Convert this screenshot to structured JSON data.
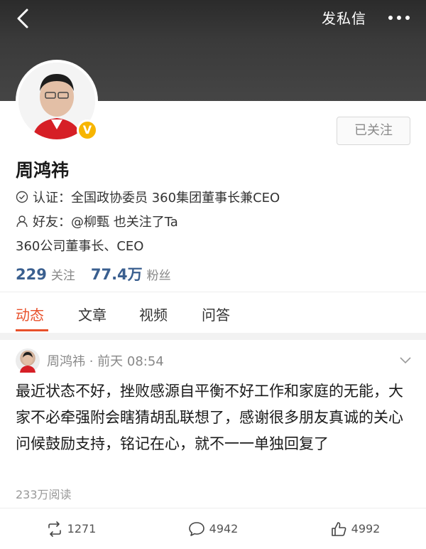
{
  "header": {
    "dm_label": "发私信"
  },
  "profile": {
    "name": "周鸿祎",
    "follow_button": "已关注",
    "cert_label": "认证：",
    "cert_text": "全国政协委员 360集团董事长兼CEO",
    "friend_label": "好友：",
    "friend_text": "@柳甄 也关注了Ta",
    "description": "360公司董事长、CEO",
    "following_count": "229",
    "following_label": "关注",
    "followers_count": "77.4万",
    "followers_label": "粉丝",
    "verified_badge": "V"
  },
  "tabs": [
    "动态",
    "文章",
    "视频",
    "问答"
  ],
  "post": {
    "meta": "周鸿祎 · 前天 08:54",
    "body": "最近状态不好，挫败感源自平衡不好工作和家庭的无能，大家不必牵强附会瞎猜胡乱联想了，感谢很多朋友真诚的关心问候鼓励支持，铭记在心，就不一一单独回复了",
    "read_count": "233万阅读",
    "repost_count": "1271",
    "comment_count": "4942",
    "like_count": "4992"
  },
  "colors": {
    "accent": "#e8502a",
    "link_blue": "#3a5f8f",
    "badge": "#f7b500"
  },
  "icons": [
    "back-icon",
    "more-icon",
    "verified-icon",
    "certified-icon",
    "friend-icon",
    "post-menu-icon",
    "repost-icon",
    "comment-icon",
    "like-icon"
  ]
}
